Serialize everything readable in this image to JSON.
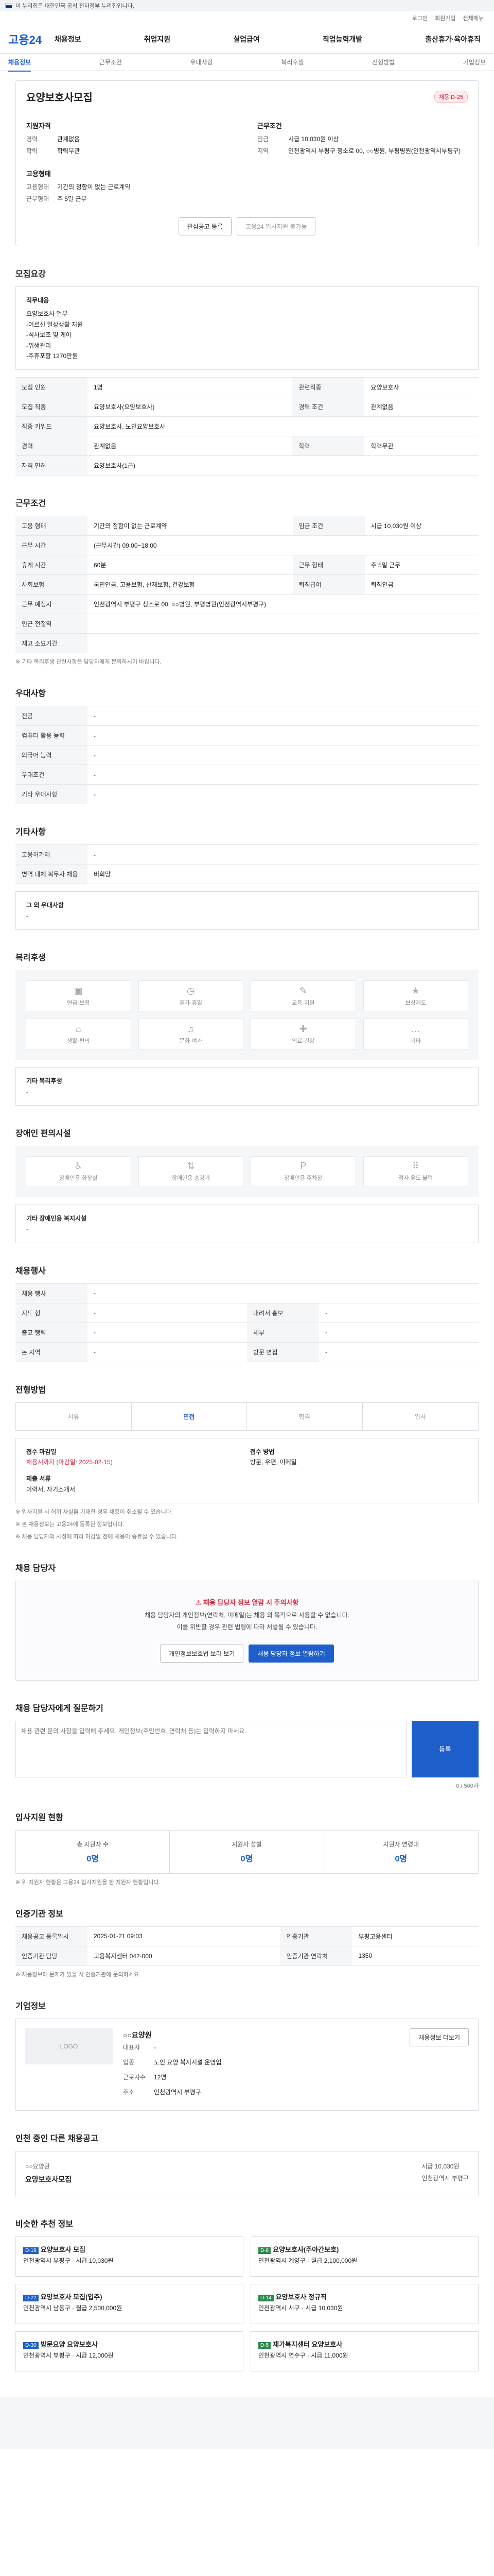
{
  "banner": {
    "text": "이 누리집은 대한민국 공식 전자정부 누리집입니다."
  },
  "util": {
    "login": "로그인",
    "signup": "회원가입",
    "sitemap": "전체메뉴"
  },
  "gnb": {
    "logo": "고용24",
    "menus": [
      "채용정보",
      "취업지원",
      "실업급여",
      "직업능력개발",
      "출산휴가·육아휴직"
    ]
  },
  "subtabs": [
    "채용정보",
    "근무조건",
    "우대사항",
    "복리후생",
    "전형방법",
    "기업정보"
  ],
  "job": {
    "badge": "채용 D-25",
    "title": "요양보호사모집",
    "summary": {
      "qual_head": "지원자격",
      "qual_rows": [
        [
          "경력",
          "관계없음"
        ],
        [
          "학력",
          "학력무관"
        ]
      ],
      "cond_head": "근무조건",
      "cond_rows": [
        [
          "임금",
          "시급 10,030원 이상"
        ],
        [
          "지역",
          "인천광역시 부평구 청소로 00, ○○병원, 부평병원(인천광역시부평구)"
        ]
      ],
      "form_head": "고용형태",
      "form_rows": [
        [
          "고용형태",
          "기간의 정함이 없는 근로계약"
        ],
        [
          "근무형태",
          "주 5일 근무"
        ]
      ]
    },
    "btn_scrap": "관심공고 등록",
    "btn_apply": "고용24 입사지원 불가능"
  },
  "recruit": {
    "title": "모집요강",
    "duties_head": "직무내용",
    "duties": "요양보호사 업무\n-어르신 일상생활 지원\n-식사보조 및 케어\n-위생관리\n-주휴포함 1270만원",
    "rows": [
      [
        "모집 인원",
        "1명",
        "관련직종",
        "요양보호사"
      ],
      [
        "모집 직종",
        "요양보호사(요양보호사)",
        "경력 조건",
        "관계없음"
      ],
      [
        "직종 키워드",
        "요양보호사, 노인요양보호사",
        "",
        ""
      ],
      [
        "경력",
        "관계없음",
        "학력",
        "학력무관"
      ],
      [
        "자격 면허",
        "요양보호사(1급)",
        "",
        ""
      ]
    ]
  },
  "work": {
    "title": "근무조건",
    "rows": [
      [
        "고용 형태",
        "기간의 정함이 없는 근로계약",
        "임금 조건",
        "시급 10,030원 이상"
      ],
      [
        "근무 시간",
        "(근무시간) 09:00~18:00",
        "",
        ""
      ],
      [
        "휴게 시간",
        "60분",
        "근무 형태",
        "주 5일 근무"
      ],
      [
        "사회보험",
        "국민연금, 고용보험, 산재보험, 건강보험",
        "퇴직급여",
        "퇴직연금"
      ],
      [
        "근무 예정지",
        "인천광역시 부평구 청소로 00, ○○병원, 부평병원(인천광역시부평구)",
        "",
        ""
      ],
      [
        "인근 전철역",
        "",
        "",
        ""
      ],
      [
        "재고 소요기간",
        "",
        "",
        ""
      ]
    ],
    "note": "※ 기타 복리후생 관련사항은 담당자에게 문의하시기 바랍니다."
  },
  "pref": {
    "title": "우대사항",
    "rows": [
      [
        "전공",
        "-"
      ],
      [
        "컴퓨터 활용 능력",
        "-"
      ],
      [
        "외국어 능력",
        "-"
      ],
      [
        "우대조건",
        "-"
      ],
      [
        "기타 우대사항",
        "-"
      ]
    ]
  },
  "etc": {
    "title": "기타사항",
    "rows": [
      [
        "고용허가제",
        "-"
      ],
      [
        "병역 대체 복무자 채용",
        "비희망"
      ]
    ],
    "extra_head": "그 외 우대사항",
    "extra": "-"
  },
  "welfare": {
    "title": "복리후생",
    "items": [
      "연금·보험",
      "휴가·휴일",
      "교육·지원",
      "보상제도",
      "생활·편의",
      "문화·여가",
      "의료·건강",
      "기타"
    ],
    "extra_head": "기타 복리후생",
    "extra": "-"
  },
  "facility": {
    "title": "장애인 편의시설",
    "items": [
      "장애인용 화장실",
      "장애인용 승강기",
      "장애인용 주차장",
      "점자 유도 블럭"
    ],
    "extra_head": "기타 장애인용 복지시설",
    "extra": "-"
  },
  "tags": {
    "title": "채용행사",
    "rows": [
      [
        "채용 행사",
        "-"
      ],
      [
        "지도 형",
        "-",
        "내려서 홍보",
        "-"
      ],
      [
        "출고 행력",
        "-",
        "세부",
        "-"
      ],
      [
        "논 지역",
        "-",
        "방문 면접",
        "-"
      ]
    ]
  },
  "process": {
    "title": "전형방법",
    "steps": [
      "서류",
      "면접",
      "합격",
      "입사"
    ],
    "period_head": "접수 마감일",
    "period": "채용시까지 (마감일: 2025-02-15)",
    "method_head": "접수 방법",
    "method": "방문, 우편, 이메일",
    "docs_head": "제출 서류",
    "docs": "이력서, 자기소개서",
    "notes": [
      "※ 입사지원 시 허위 사실을 기재한 경우 채용이 취소될 수 있습니다.",
      "※ 본 채용정보는 고용24에 등록된 정보입니다.",
      "※ 채용 담당자의 사정에 따라 마감일 전에 채용이 종료될 수 있습니다."
    ]
  },
  "contact": {
    "title": "채용 담당자",
    "warn": "채용 담당자 정보 열람 시 주의사항",
    "lines": [
      "채용 담당자의 개인정보(연락처, 이메일)는 채용 외 목적으로 사용할 수 없습니다.",
      "이를 위반할 경우 관련 법령에 따라 처벌될 수 있습니다."
    ],
    "btn1": "개인정보보호법 보러 보기",
    "btn2": "채용 담당자 정보 열람하기"
  },
  "qna": {
    "title": "채용 담당자에게 질문하기",
    "placeholder": "채용 관련 문의 사항을 입력해 주세요. 개인정보(주민번호, 연락처 등)는 입력하지 마세요.",
    "submit": "등록",
    "count": "0 / 500자"
  },
  "stats": {
    "title": "입사지원 현황",
    "items": [
      [
        "총 지원자 수",
        "0명"
      ],
      [
        "지원자 성별",
        "0명"
      ],
      [
        "지원자 연령대",
        "0명"
      ]
    ],
    "note": "※ 위 지원자 현황은 고용24 입사지원을 한 지원자 현황입니다."
  },
  "info": {
    "title": "인증기관 정보",
    "rows": [
      [
        "채용공고 등록일시",
        "2025-01-21 09:03",
        "인증기관",
        "부평고용센터"
      ],
      [
        "인증기관 담당",
        "고용복지센터 042-000",
        "인증기관 연락처",
        "1350"
      ]
    ],
    "note": "※ 채용정보에 문제가 있을 시 인증기관에 문의하세요."
  },
  "company": {
    "title": "기업정보",
    "logo": "LOGO",
    "name": "○○요양원",
    "rows": [
      [
        "기업명",
        "○○요양원"
      ],
      [
        "대표자",
        "-"
      ],
      [
        "업종",
        "노인 요양 복지시설 운영업"
      ],
      [
        "근로자수",
        "12명"
      ],
      [
        "주소",
        "인천광역시 부평구"
      ]
    ],
    "btn": "채용정보 더보기"
  },
  "related": {
    "title": "인천 중인 다른 채용공고",
    "name": "○○요양원",
    "job": "요양보호사모집",
    "wage": "시급 10,030원",
    "place": "인천광역시 부평구"
  },
  "recommend": {
    "title": "비슷한 추천 정보",
    "cards": [
      [
        "D-19",
        "요양보호사 모집",
        "인천광역시 부평구 · 시급 10,030원"
      ],
      [
        "D-8",
        "요양보호사(주야간보호)",
        "인천광역시 계양구 · 월급 2,100,000원"
      ],
      [
        "D-22",
        "요양보호사 모집(입주)",
        "인천광역시 남동구 · 월급 2,500,000원"
      ],
      [
        "D-14",
        "요양보호사 정규직",
        "인천광역시 서구 · 시급 10,030원"
      ],
      [
        "D-30",
        "방문요양 요양보호사",
        "인천광역시 부평구 · 시급 12,000원"
      ],
      [
        "D-5",
        "재가복지센터 요양보호사",
        "인천광역시 연수구 · 시급 11,000원"
      ]
    ]
  }
}
